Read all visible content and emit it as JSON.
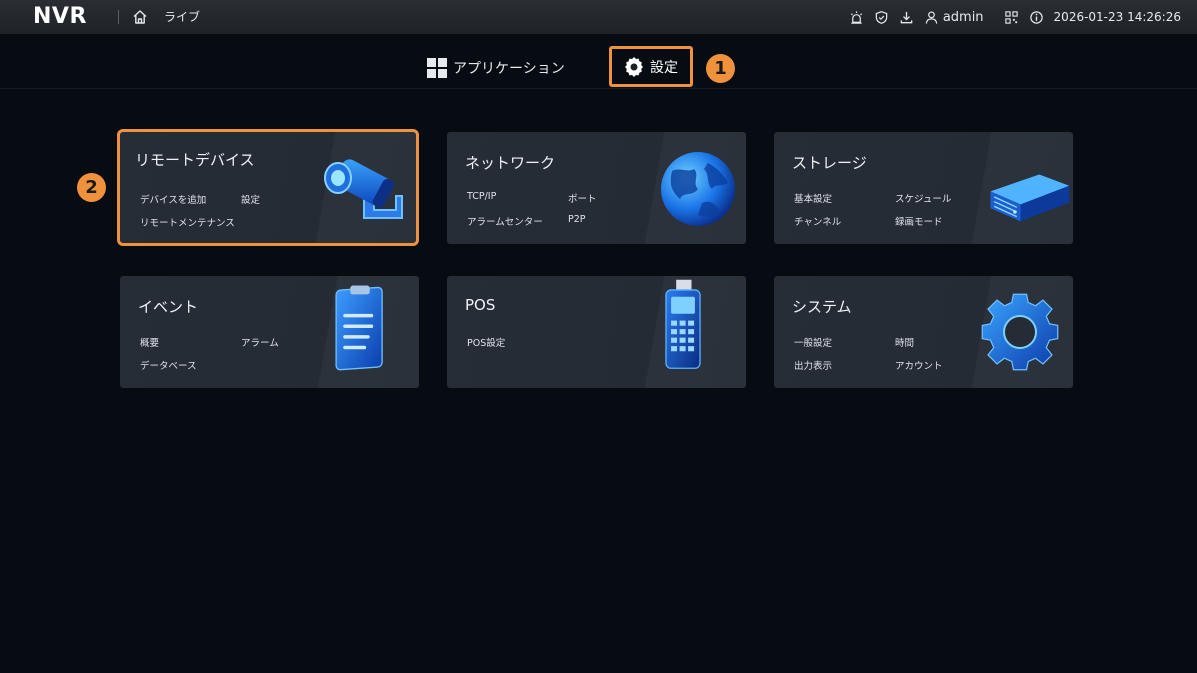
{
  "header": {
    "brand": "NVR",
    "live_label": "ライブ",
    "username": "admin",
    "datetime": "2026-01-23 14:26:26"
  },
  "tabs": {
    "applications": "アプリケーション",
    "settings": "設定"
  },
  "markers": {
    "one": "1",
    "two": "2"
  },
  "cards": [
    {
      "title": "リモートデバイス",
      "links": [
        "デバイスを追加",
        "設定",
        "リモートメンテナンス"
      ],
      "icon": "camera-icon"
    },
    {
      "title": "ネットワーク",
      "links": [
        "TCP/IP",
        "ポート",
        "アラームセンター",
        "P2P"
      ],
      "icon": "globe-icon"
    },
    {
      "title": "ストレージ",
      "links": [
        "基本設定",
        "スケジュール",
        "チャンネル",
        "録画モード"
      ],
      "icon": "hard-drive-icon"
    },
    {
      "title": "イベント",
      "links": [
        "概要",
        "アラーム",
        "データベース"
      ],
      "icon": "clipboard-icon"
    },
    {
      "title": "POS",
      "links": [
        "POS設定"
      ],
      "icon": "pos-terminal-icon"
    },
    {
      "title": "システム",
      "links": [
        "一般設定",
        "時間",
        "出力表示",
        "アカウント"
      ],
      "icon": "gear-icon"
    }
  ],
  "colors": {
    "accent": "#f0923c",
    "background": "#070b12",
    "card": "#262c35",
    "icon_blue": "#1e7bff"
  }
}
